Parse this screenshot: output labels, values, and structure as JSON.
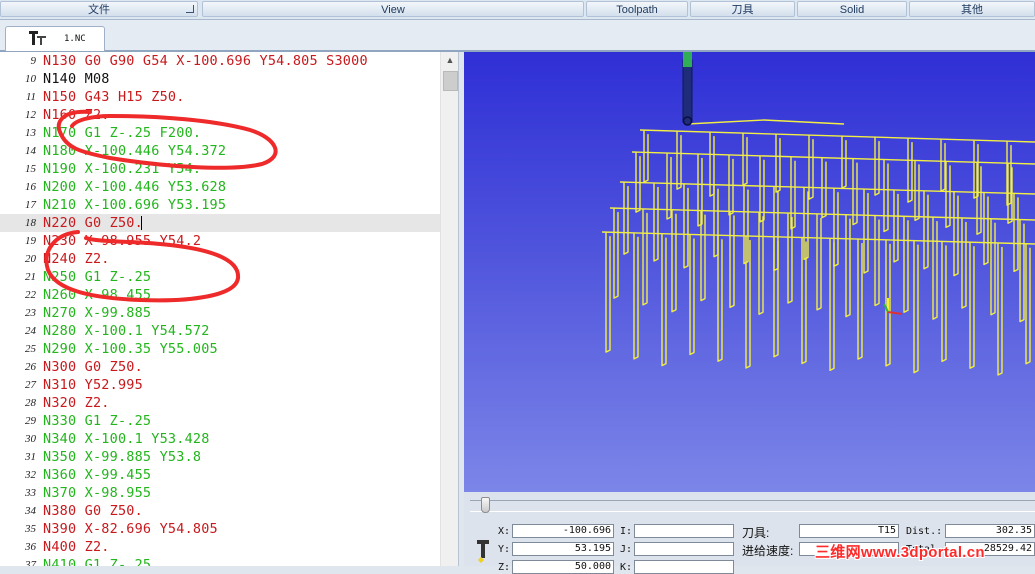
{
  "menu": {
    "items": [
      {
        "label": "文件",
        "has_launcher": true
      },
      {
        "label": "View",
        "has_launcher": false
      },
      {
        "label": "Toolpath",
        "has_launcher": false
      },
      {
        "label": "刀具",
        "has_launcher": false
      },
      {
        "label": "Solid",
        "has_launcher": false
      },
      {
        "label": "其他",
        "has_launcher": false
      }
    ]
  },
  "tab": {
    "label": "1.NC",
    "icon": "nc-file-icon"
  },
  "editor": {
    "current_line": 18,
    "lines": [
      {
        "n": "9",
        "text": "N130 G0 G90 G54 X-100.696 Y54.805 S3000",
        "color": "red"
      },
      {
        "n": "10",
        "text": "N140 M08",
        "color": "black"
      },
      {
        "n": "11",
        "text": "N150 G43 H15 Z50.",
        "color": "red"
      },
      {
        "n": "12",
        "text": "N160 Z2.",
        "color": "red"
      },
      {
        "n": "13",
        "text": "N170 G1 Z-.25 F200.",
        "color": "green"
      },
      {
        "n": "14",
        "text": "N180 X-100.446 Y54.372",
        "color": "green"
      },
      {
        "n": "15",
        "text": "N190 X-100.231 Y54.",
        "color": "green"
      },
      {
        "n": "16",
        "text": "N200 X-100.446 Y53.628",
        "color": "green"
      },
      {
        "n": "17",
        "text": "N210 X-100.696 Y53.195",
        "color": "green"
      },
      {
        "n": "18",
        "text": "N220 G0 Z50.",
        "color": "red"
      },
      {
        "n": "19",
        "text": "N230 X-98.955 Y54.2",
        "color": "red"
      },
      {
        "n": "20",
        "text": "N240 Z2.",
        "color": "red"
      },
      {
        "n": "21",
        "text": "N250 G1 Z-.25",
        "color": "green"
      },
      {
        "n": "22",
        "text": "N260 X-98.455",
        "color": "green"
      },
      {
        "n": "23",
        "text": "N270 X-99.885",
        "color": "green"
      },
      {
        "n": "24",
        "text": "N280 X-100.1 Y54.572",
        "color": "green"
      },
      {
        "n": "25",
        "text": "N290 X-100.35 Y55.005",
        "color": "green"
      },
      {
        "n": "26",
        "text": "N300 G0 Z50.",
        "color": "red"
      },
      {
        "n": "27",
        "text": "N310 Y52.995",
        "color": "red"
      },
      {
        "n": "28",
        "text": "N320 Z2.",
        "color": "red"
      },
      {
        "n": "29",
        "text": "N330 G1 Z-.25",
        "color": "green"
      },
      {
        "n": "30",
        "text": "N340 X-100.1 Y53.428",
        "color": "green"
      },
      {
        "n": "31",
        "text": "N350 X-99.885 Y53.8",
        "color": "green"
      },
      {
        "n": "32",
        "text": "N360 X-99.455",
        "color": "green"
      },
      {
        "n": "33",
        "text": "N370 X-98.955",
        "color": "green"
      },
      {
        "n": "34",
        "text": "N380 G0 Z50.",
        "color": "red"
      },
      {
        "n": "35",
        "text": "N390 X-82.696 Y54.805",
        "color": "red"
      },
      {
        "n": "36",
        "text": "N400 Z2.",
        "color": "red"
      },
      {
        "n": "37",
        "text": "N410 G1 Z-.25",
        "color": "green"
      }
    ]
  },
  "colors": {
    "rapid": "#c8191d",
    "feed": "#22b51c",
    "normal": "#111111",
    "annotation": "#ee2a2a",
    "toolpath": "#f2ee43",
    "viewport_top": "#2f2fd6",
    "viewport_bottom": "#7c86e8"
  },
  "status": {
    "x_label": "X:",
    "x_value": "-100.696",
    "y_label": "Y:",
    "y_value": "53.195",
    "z_label": "Z:",
    "z_value": "50.000",
    "i_label": "I:",
    "i_value": "",
    "j_label": "J:",
    "j_value": "",
    "k_label": "K:",
    "k_value": "",
    "tool_label": "刀具:",
    "tool_value": "T15",
    "feed_label": "进给速度:",
    "feed_value": "",
    "dist_label": "Dist.:",
    "dist_value": "302.35",
    "total_label": "Total",
    "total_value": "28529.42",
    "timeline_position": 0.02
  },
  "watermark": "三维网www.3dportal.cn"
}
